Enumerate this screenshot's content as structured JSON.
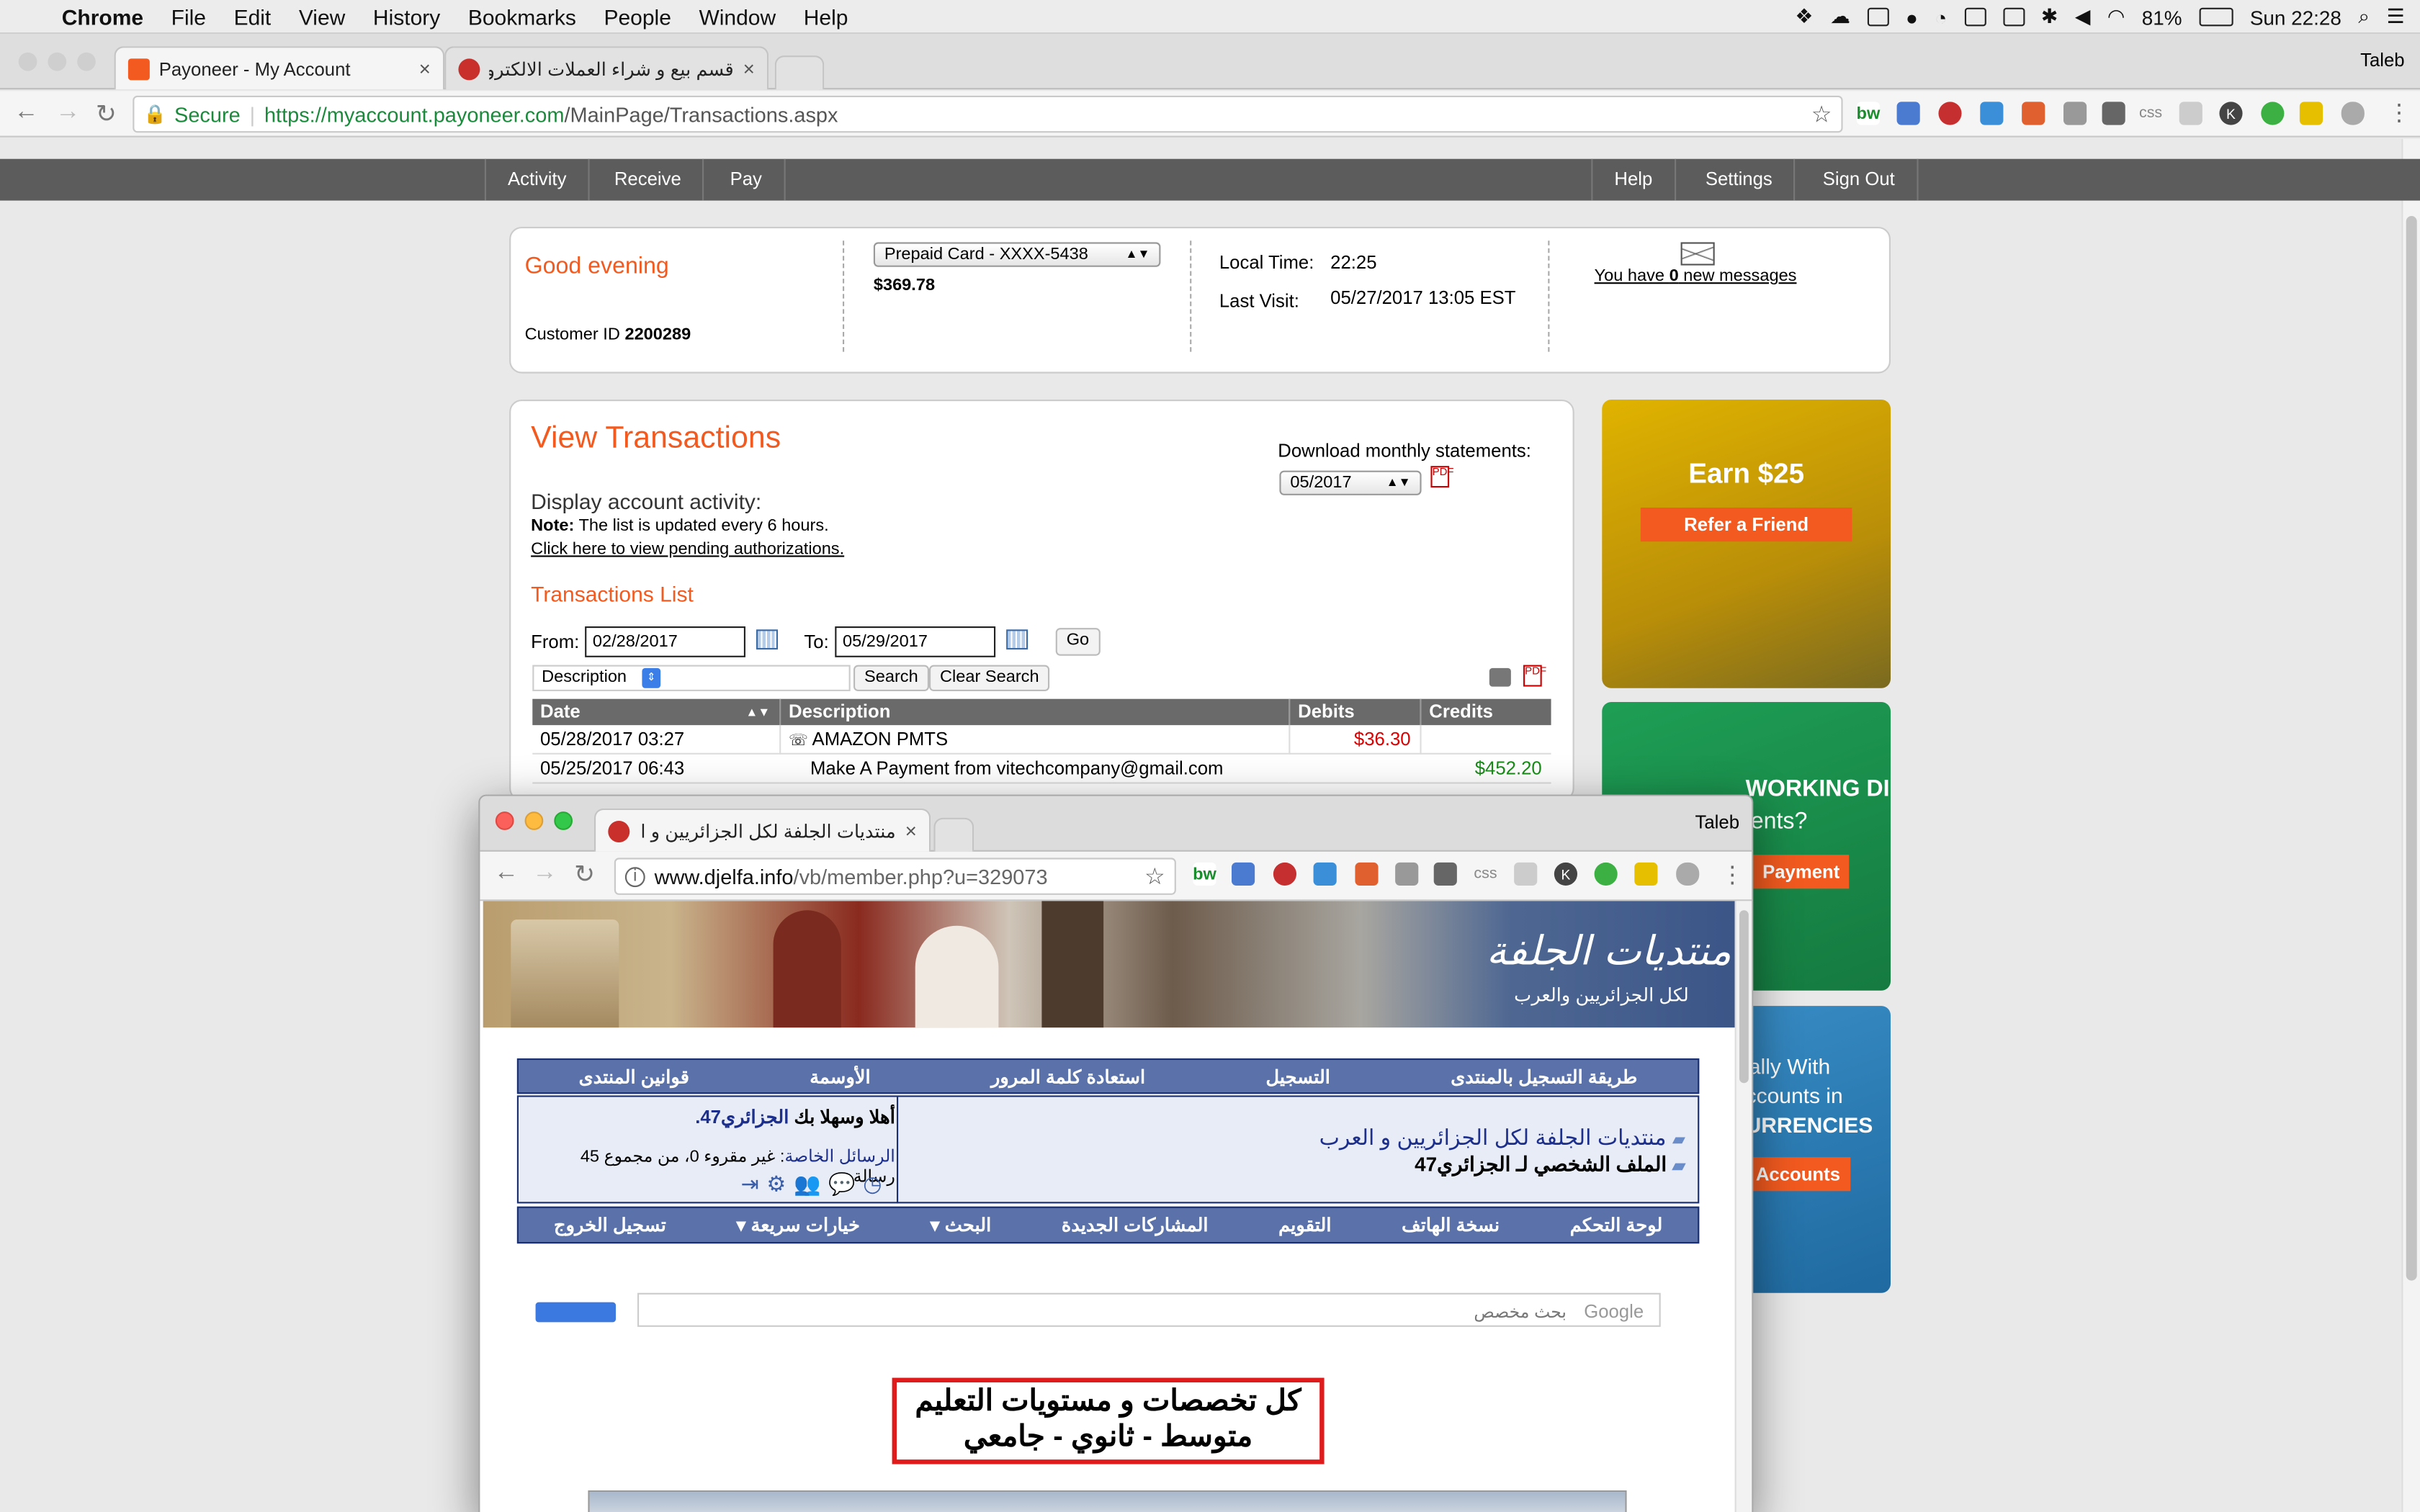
{
  "menubar": {
    "app": "Chrome",
    "items": [
      "File",
      "Edit",
      "View",
      "History",
      "Bookmarks",
      "People",
      "Window",
      "Help"
    ],
    "battery": "81%",
    "clock": "Sun 22:28"
  },
  "browser": {
    "profile": "Taleb",
    "tabs": [
      {
        "label": "Payoneer - My Account"
      },
      {
        "label": "قسم بيع و شراء العملات الالكترونية - منتدي"
      }
    ],
    "secure": "Secure",
    "url_host": "https://myaccount.payoneer.com",
    "url_path": "/MainPage/Transactions.aspx",
    "ext_css": "css"
  },
  "payoneer": {
    "nav_left": [
      "Activity",
      "Receive",
      "Pay"
    ],
    "nav_right": [
      "Help",
      "Settings",
      "Sign Out"
    ],
    "greeting": "Good evening",
    "customer_label": "Customer ID",
    "customer_id": "2200289",
    "card_select": "Prepaid Card - XXXX-5438",
    "balance": "$369.78",
    "local_time_label": "Local Time:",
    "local_time": "22:25",
    "last_visit_label": "Last Visit:",
    "last_visit": "05/27/2017 13:05 EST",
    "msg_prefix": "You have ",
    "msg_count": "0",
    "msg_suffix": " new messages",
    "title": "View Transactions",
    "download_label": "Download monthly statements:",
    "download_month": "05/2017",
    "activity_label": "Display account activity:",
    "note_label": "Note:",
    "note_text": " The list is updated every 6 hours.",
    "pending_link": "Click here to view pending authorizations.",
    "list_title": "Transactions List",
    "from_label": "From:",
    "from_value": "02/28/2017",
    "to_label": "To:",
    "to_value": "05/29/2017",
    "go": "Go",
    "search_field": "Description",
    "search_btn": "Search",
    "clear_btn": "Clear Search",
    "columns": [
      "Date",
      "Description",
      "Debits",
      "Credits"
    ],
    "rows": [
      {
        "date": "05/28/2017 03:27",
        "desc": "AMAZON PMTS",
        "debit": "$36.30",
        "credit": ""
      },
      {
        "date": "05/25/2017 06:43",
        "desc": "Make A Payment from vitechcompany@gmail.com",
        "debit": "",
        "credit": "$452.20"
      }
    ],
    "promo1_title": "Earn $25",
    "promo1_btn": "Refer a Friend",
    "promo2_title": "WORKING DIRECTLY",
    "promo2_sub": "ients?",
    "promo2_btn": "Payment",
    "promo3_line1": "ally With",
    "promo3_line2": "ccounts in",
    "promo3_line3": "URRENCIES",
    "promo3_btn": "Accounts"
  },
  "win2": {
    "profile": "Taleb",
    "tab_label": "منتديات الجلفة لكل الجزائريين و العرب - م",
    "url_host": "www.djelfa.info",
    "url_path": "/vb/member.php?u=329073",
    "ext_css": "css",
    "logo_main": "منتديات الجلفة",
    "logo_sub": "لكل الجزائريين والعرب",
    "top_nav": [
      "طريقة التسجيل بالمنتدى",
      "التسجيل",
      "استعادة كلمة المرور",
      "الأوسمة",
      "قوانين المنتدى"
    ],
    "forum_name": "منتديات الجلفة لكل الجزائريين و العرب",
    "profile_title": "الملف الشخصي لـ الجزائري47",
    "welcome": "أهلا وسهلا بك",
    "username": "الجزائري47.",
    "pm_label": "الرسائل الخاصة",
    "pm_text": ": غير مقروء 0، من مجموع 45 رسالة.",
    "bottom_nav": [
      "لوحة التحكم",
      "نسخة الهاتف",
      "التقويم",
      "المشاركات الجديدة",
      "البحث",
      "خيارات سريعة",
      "تسجيل الخروج"
    ],
    "search_placeholder": "بحث مخصص",
    "google": "Google",
    "banner_l1": "كل تخصصات و مستويات التعليم",
    "banner_l2": "متوسط - ثانوي - جامعي"
  }
}
